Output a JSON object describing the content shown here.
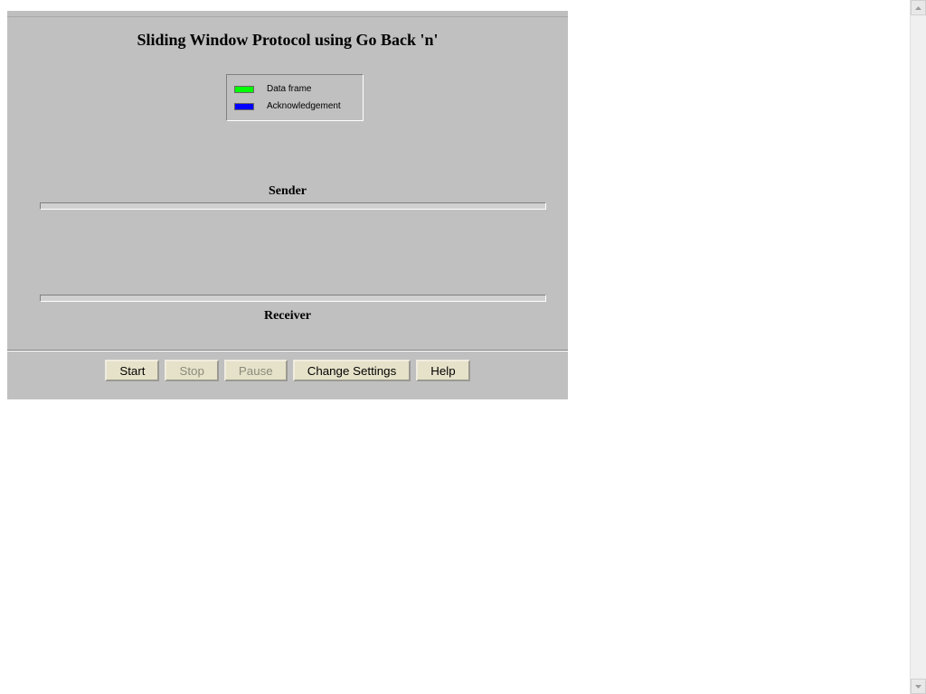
{
  "title": "Sliding Window Protocol using Go Back 'n'",
  "legend": {
    "data_frame": "Data frame",
    "ack": "Acknowledgement"
  },
  "labels": {
    "sender": "Sender",
    "receiver": "Receiver"
  },
  "buttons": {
    "start": "Start",
    "stop": "Stop",
    "pause": "Pause",
    "change_settings": "Change Settings",
    "help": "Help"
  },
  "colors": {
    "data_frame": "#00ff00",
    "ack": "#0000ff",
    "panel": "#c0c0c0"
  }
}
